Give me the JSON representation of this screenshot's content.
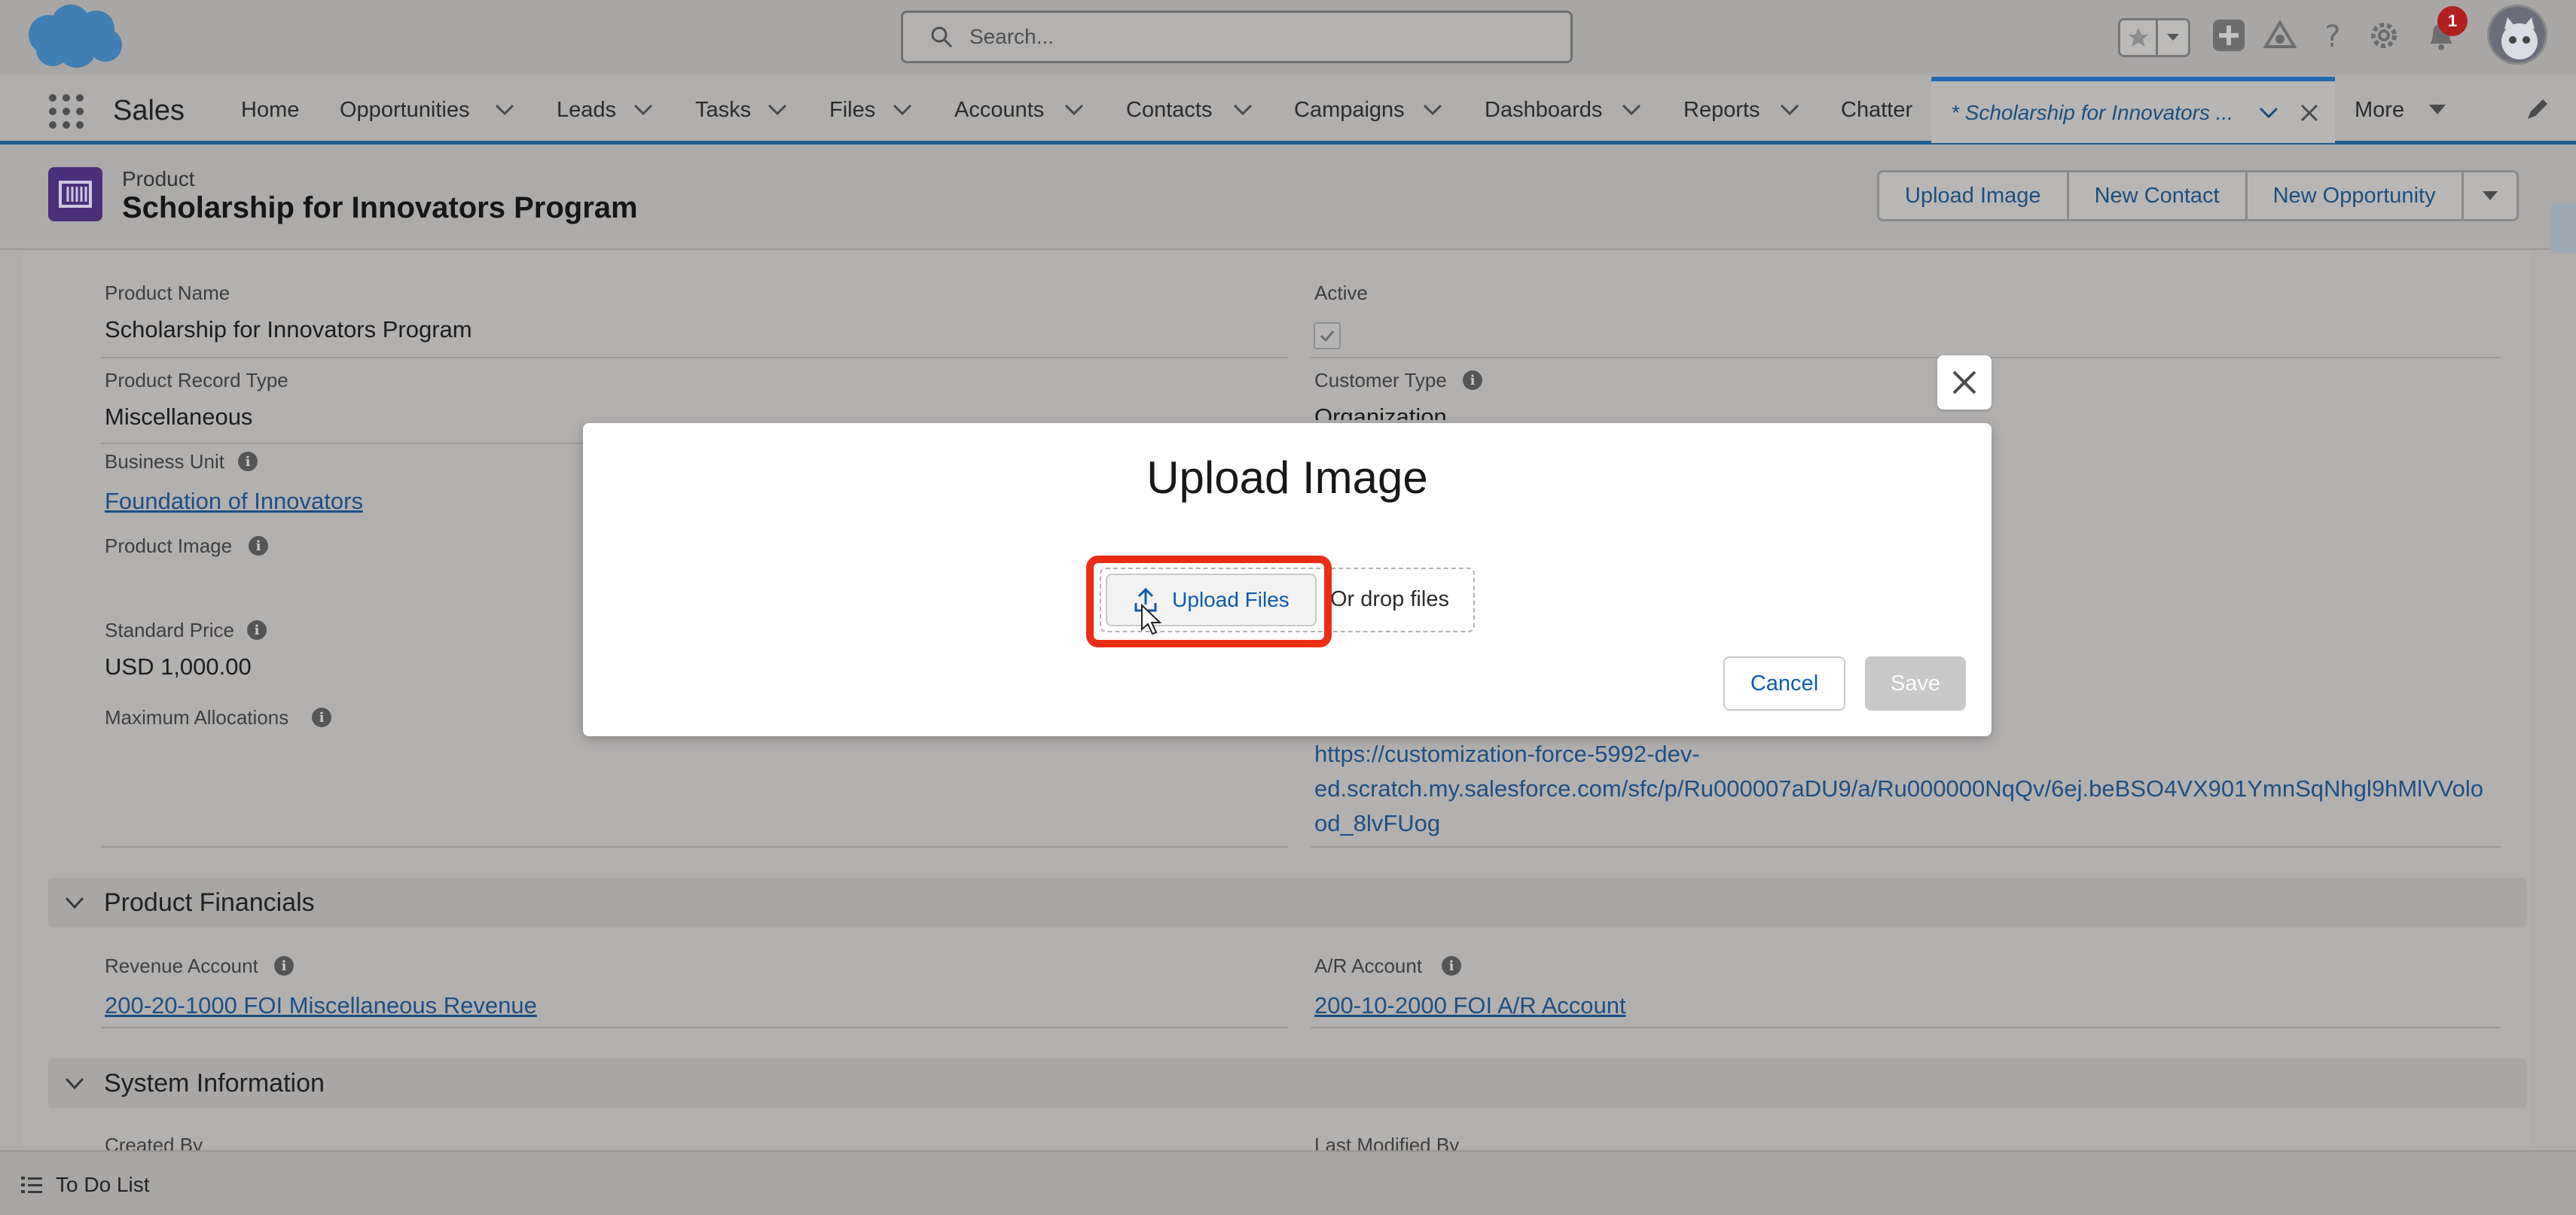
{
  "header": {
    "search_placeholder": "Search...",
    "notification_count": "1"
  },
  "nav": {
    "app_name": "Sales",
    "items": [
      {
        "label": "Home"
      },
      {
        "label": "Opportunities"
      },
      {
        "label": "Leads"
      },
      {
        "label": "Tasks"
      },
      {
        "label": "Files"
      },
      {
        "label": "Accounts"
      },
      {
        "label": "Contacts"
      },
      {
        "label": "Campaigns"
      },
      {
        "label": "Dashboards"
      },
      {
        "label": "Reports"
      },
      {
        "label": "Chatter"
      }
    ],
    "active_tab": "* Scholarship for Innovators ...",
    "more": "More"
  },
  "record": {
    "type": "Product",
    "title": "Scholarship for Innovators Program",
    "actions": [
      "Upload Image",
      "New Contact",
      "New Opportunity"
    ]
  },
  "fields": {
    "product_name_label": "Product Name",
    "product_name_value": "Scholarship for Innovators Program",
    "active_label": "Active",
    "record_type_label": "Product Record Type",
    "record_type_value": "Miscellaneous",
    "customer_type_label": "Customer Type",
    "customer_type_value": "Organization",
    "business_unit_label": "Business Unit",
    "business_unit_value": "Foundation of Innovators",
    "product_image_label": "Product Image",
    "standard_price_label": "Standard Price",
    "standard_price_value": "USD 1,000.00",
    "max_alloc_label": "Maximum Allocations",
    "url_line1": "https://customization-force-5992-dev-",
    "url_line2": "ed.scratch.my.salesforce.com/sfc/p/Ru000007aDU9/a/Ru000000NqQv/6ej.beBSO4VX901YmnSqNhgl9hMlVVolo",
    "url_line3": "od_8lvFUog"
  },
  "financials": {
    "section_title": "Product Financials",
    "revenue_label": "Revenue Account",
    "revenue_value": "200-20-1000 FOI Miscellaneous Revenue",
    "ar_label": "A/R Account",
    "ar_value": "200-10-2000 FOI A/R Account"
  },
  "system": {
    "section_title": "System Information",
    "created_by_label": "Created By",
    "last_modified_label": "Last Modified By"
  },
  "utility": {
    "todo_label": "To Do List"
  },
  "modal": {
    "title": "Upload Image",
    "upload_label": "Upload Files",
    "drop_text": "Or drop files",
    "cancel_label": "Cancel",
    "save_label": "Save"
  },
  "colors": {
    "brand_blue": "#1d6ab0",
    "highlight_red": "#ea2d15",
    "product_icon": "#4b2f7a",
    "link": "#0b5cab"
  }
}
